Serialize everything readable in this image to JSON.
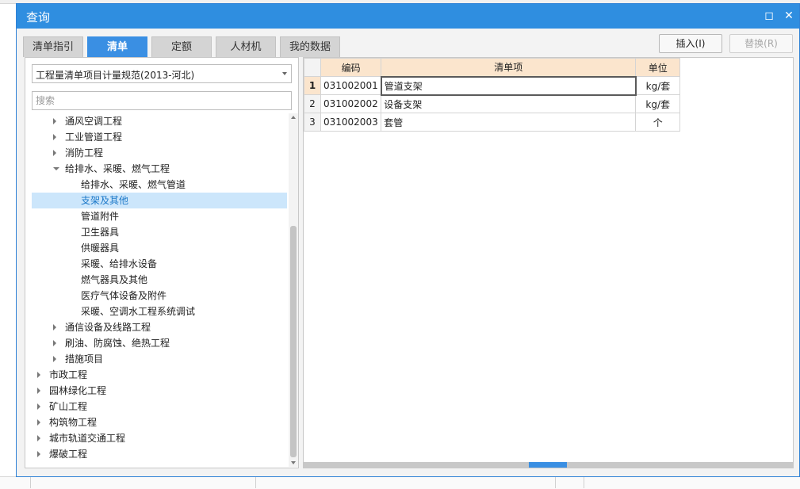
{
  "dialog": {
    "title": "查询",
    "maximize_glyph": "◻",
    "close_glyph": "✕"
  },
  "tabs": [
    {
      "label": "清单指引",
      "active": false
    },
    {
      "label": "清单",
      "active": true
    },
    {
      "label": "定额",
      "active": false
    },
    {
      "label": "人材机",
      "active": false
    },
    {
      "label": "我的数据",
      "active": false
    }
  ],
  "actions": {
    "insert_label": "插入(I)",
    "replace_label": "替换(R)"
  },
  "left": {
    "spec_select_value": "工程量清单项目计量规范(2013-河北)",
    "search_placeholder": "搜索",
    "tree": [
      {
        "label": "通风空调工程",
        "level": 1,
        "state": "collapsed"
      },
      {
        "label": "工业管道工程",
        "level": 1,
        "state": "collapsed"
      },
      {
        "label": "消防工程",
        "level": 1,
        "state": "collapsed"
      },
      {
        "label": "给排水、采暖、燃气工程",
        "level": 1,
        "state": "expanded"
      },
      {
        "label": "给排水、采暖、燃气管道",
        "level": 2,
        "state": "leaf"
      },
      {
        "label": "支架及其他",
        "level": 2,
        "state": "leaf",
        "selected": true
      },
      {
        "label": "管道附件",
        "level": 2,
        "state": "leaf"
      },
      {
        "label": "卫生器具",
        "level": 2,
        "state": "leaf"
      },
      {
        "label": "供暖器具",
        "level": 2,
        "state": "leaf"
      },
      {
        "label": "采暖、给排水设备",
        "level": 2,
        "state": "leaf"
      },
      {
        "label": "燃气器具及其他",
        "level": 2,
        "state": "leaf"
      },
      {
        "label": "医疗气体设备及附件",
        "level": 2,
        "state": "leaf"
      },
      {
        "label": "采暖、空调水工程系统调试",
        "level": 2,
        "state": "leaf"
      },
      {
        "label": "通信设备及线路工程",
        "level": 1,
        "state": "collapsed"
      },
      {
        "label": "刷油、防腐蚀、绝热工程",
        "level": 1,
        "state": "collapsed"
      },
      {
        "label": "措施项目",
        "level": 1,
        "state": "collapsed"
      },
      {
        "label": "市政工程",
        "level": 0,
        "state": "collapsed"
      },
      {
        "label": "园林绿化工程",
        "level": 0,
        "state": "collapsed"
      },
      {
        "label": "矿山工程",
        "level": 0,
        "state": "collapsed"
      },
      {
        "label": "构筑物工程",
        "level": 0,
        "state": "collapsed"
      },
      {
        "label": "城市轨道交通工程",
        "level": 0,
        "state": "collapsed"
      },
      {
        "label": "爆破工程",
        "level": 0,
        "state": "collapsed"
      }
    ]
  },
  "grid": {
    "columns": {
      "code": "编码",
      "name": "清单项",
      "unit": "单位"
    },
    "rows": [
      {
        "no": "1",
        "code": "031002001",
        "name": "管道支架",
        "unit": "kg/套"
      },
      {
        "no": "2",
        "code": "031002002",
        "name": "设备支架",
        "unit": "kg/套"
      },
      {
        "no": "3",
        "code": "031002003",
        "name": "套管",
        "unit": "个"
      }
    ]
  }
}
